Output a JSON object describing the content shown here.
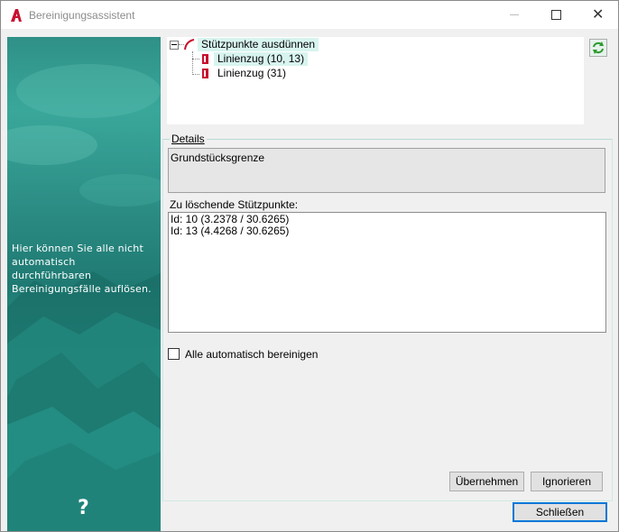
{
  "window": {
    "title": "Bereinigungsassistent",
    "icon": "autocad-a-icon"
  },
  "banner": {
    "text": "Hier können Sie alle nicht automatisch durchführbaren Bereinigungsfälle auflösen.",
    "help_symbol": "?"
  },
  "tree": {
    "root_label": "Stützpunkte ausdünnen",
    "children": [
      {
        "label": "Linienzug (10, 13)"
      },
      {
        "label": "Linienzug (31)"
      }
    ]
  },
  "details": {
    "legend": "Details",
    "description": "Grundstücksgrenze",
    "points_label": "Zu löschende Stützpunkte:",
    "points": [
      "Id: 10 (3.2378 / 30.6265)",
      "Id: 13 (4.4268 / 30.6265)"
    ],
    "auto_checkbox_label": "Alle automatisch bereinigen",
    "auto_checked": false
  },
  "buttons": {
    "apply": "Übernehmen",
    "ignore": "Ignorieren",
    "close": "Schließen"
  },
  "colors": {
    "accent_teal": "#2f9a8e",
    "selection": "#d8f4ef",
    "default_button_border": "#0078d7"
  }
}
